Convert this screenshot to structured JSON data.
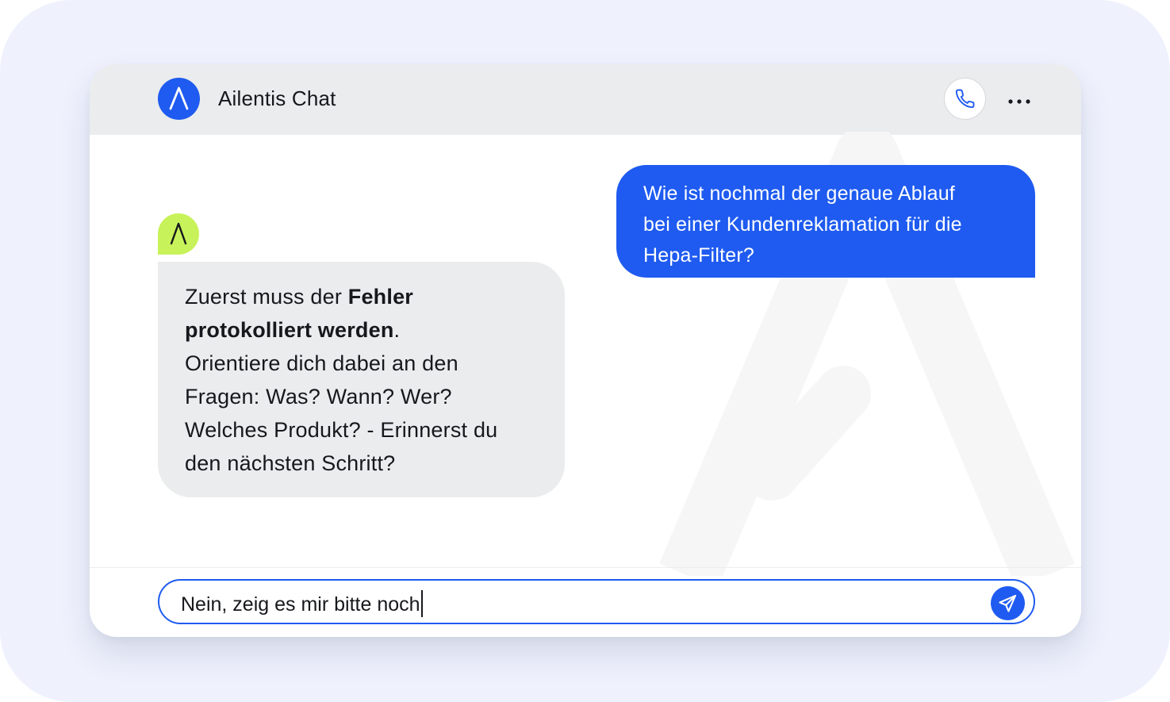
{
  "app": {
    "title": "Ailentis Chat"
  },
  "header": {
    "logo_icon": "ailentis-logo-icon",
    "call_icon": "phone-icon",
    "more_icon": "more-horizontal-icon"
  },
  "messages": [
    {
      "role": "user",
      "lines": [
        "Wie ist nochmal der genaue Ablauf",
        "bei einer Kundenreklamation für die",
        "Hepa-Filter?"
      ]
    },
    {
      "role": "assistant",
      "avatar_icon": "ailentis-bot-avatar-icon",
      "segments": {
        "line1_normal": "Zuerst muss der ",
        "line1_bold": "Fehler",
        "line2_bold": "protokolliert werden",
        "line2_normal": ".",
        "line3": "Orientiere dich dabei an den",
        "line4": "Fragen: Was? Wann? Wer?",
        "line5": "Welches Produkt? - Erinnerst du",
        "line6": "den nächsten Schritt?"
      }
    }
  ],
  "composer": {
    "value": "Nein, zeig es mir bitte noch",
    "send_icon": "send-icon"
  },
  "colors": {
    "accent": "#1f5bf0",
    "bot_avatar": "#c8f25a",
    "header_bg": "#ebeced",
    "bot_bubble": "#ebeced",
    "backdrop": "#eff2fd"
  }
}
